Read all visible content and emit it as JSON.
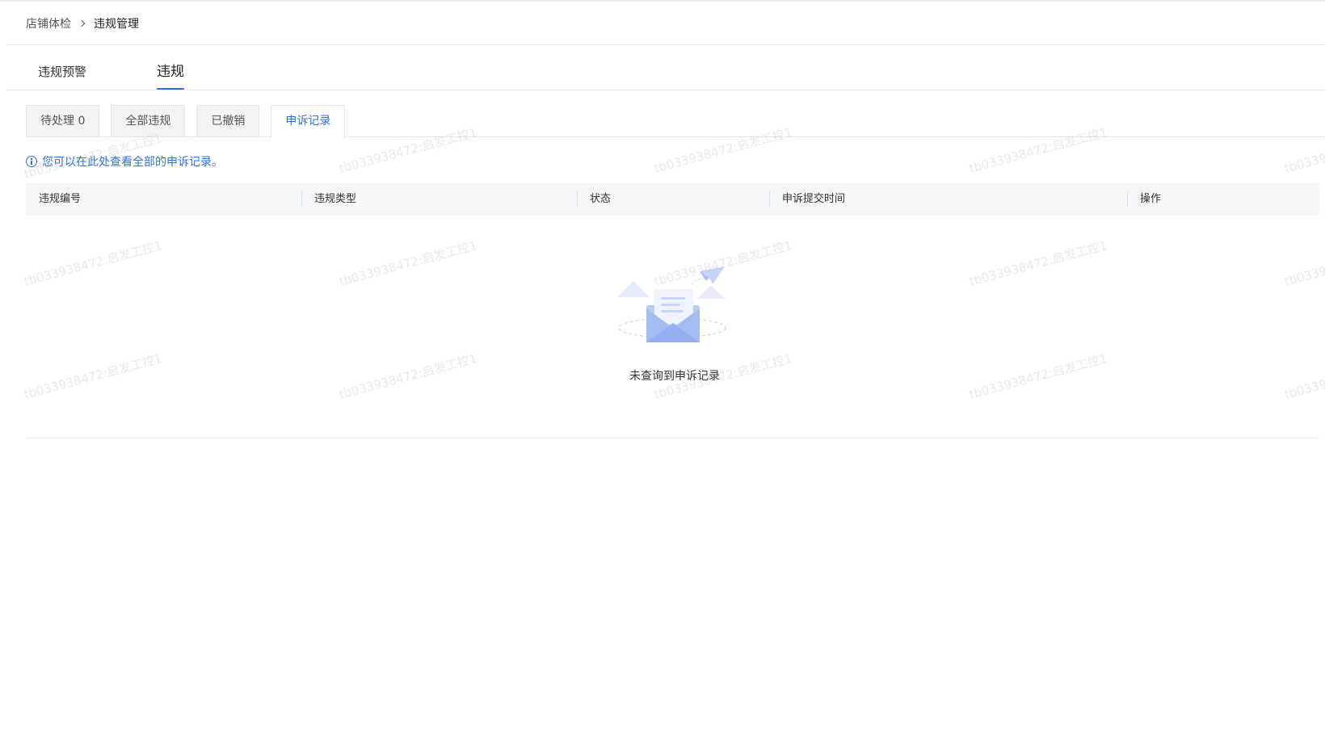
{
  "breadcrumb": {
    "parent": "店铺体检",
    "current": "违规管理"
  },
  "main_tabs": [
    {
      "label": "违规预警",
      "active": false
    },
    {
      "label": "违规",
      "active": true
    }
  ],
  "sub_tabs": [
    {
      "label": "待处理 0",
      "active": false
    },
    {
      "label": "全部违规",
      "active": false
    },
    {
      "label": "已撤销",
      "active": false
    },
    {
      "label": "申诉记录",
      "active": true
    }
  ],
  "notice": {
    "icon": "info-icon",
    "text": "您可以在此处查看全部的申诉记录。"
  },
  "table": {
    "columns": [
      "违规编号",
      "违规类型",
      "状态",
      "申诉提交时间",
      "操作"
    ],
    "rows": [],
    "empty_text": "未查询到申诉记录"
  },
  "watermark": {
    "text": "tb033938472:启发工控1"
  },
  "colors": {
    "accent": "#2e6fe8",
    "header_bg": "#f5f6f8",
    "tab_bg": "#f2f3f5"
  }
}
